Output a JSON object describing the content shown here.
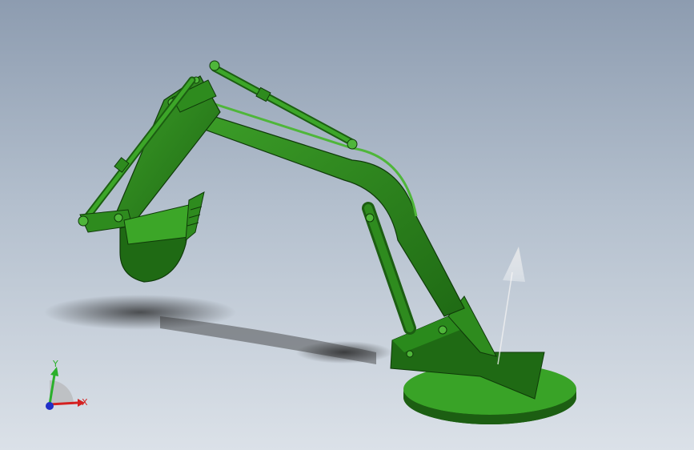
{
  "viewport": {
    "background_top": "#8d9cb0",
    "background_bottom": "#dbe1e8",
    "model": {
      "name": "excavator-arm",
      "color_main": "#2e8b1e",
      "color_dark": "#1c5e12",
      "color_light": "#4fb63a"
    }
  },
  "triad": {
    "x_label": "X",
    "y_label": "Y",
    "x_color": "#d42020",
    "y_color": "#2bb02b",
    "z_color": "#2030c8"
  }
}
